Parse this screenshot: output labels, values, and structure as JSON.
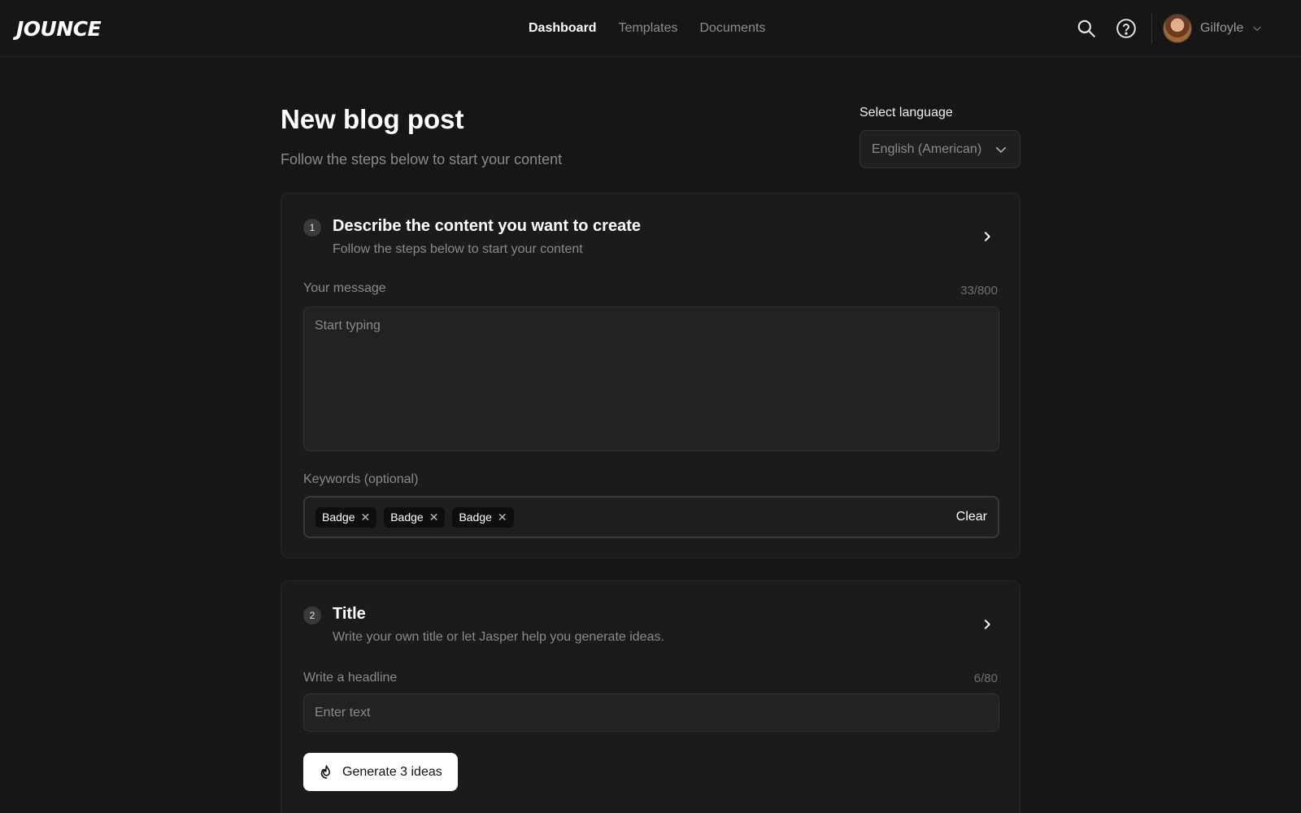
{
  "app": {
    "logo": "JOUNCE"
  },
  "nav": {
    "items": [
      {
        "label": "Dashboard",
        "active": true
      },
      {
        "label": "Templates",
        "active": false
      },
      {
        "label": "Documents",
        "active": false
      }
    ]
  },
  "header_icons": [
    "search-icon",
    "help-icon"
  ],
  "user": {
    "name": "Gilfoyle"
  },
  "page": {
    "title": "New blog post",
    "subtitle": "Follow the steps below to start your content"
  },
  "language": {
    "label": "Select language",
    "selected": "English (American)"
  },
  "step1": {
    "number": "1",
    "title": "Describe the content you want to create",
    "subtitle": "Follow the steps below to start your content",
    "message_label": "Your message",
    "message_counter": "33/800",
    "message_placeholder": "Start typing",
    "keywords_label": "Keywords (optional)",
    "keywords": [
      "Badge",
      "Badge",
      "Badge"
    ],
    "clear_label": "Clear"
  },
  "step2": {
    "number": "2",
    "title": "Title",
    "subtitle": "Write your own title or let Jasper help you generate ideas.",
    "headline_label": "Write a headline",
    "headline_counter": "6/80",
    "headline_placeholder": "Enter text",
    "generate_label": "Generate 3 ideas"
  },
  "colors": {
    "background": "#161616",
    "card": "#1b1b1b",
    "accent_button": "#ffffff",
    "muted_text": "#8a8a8a"
  }
}
